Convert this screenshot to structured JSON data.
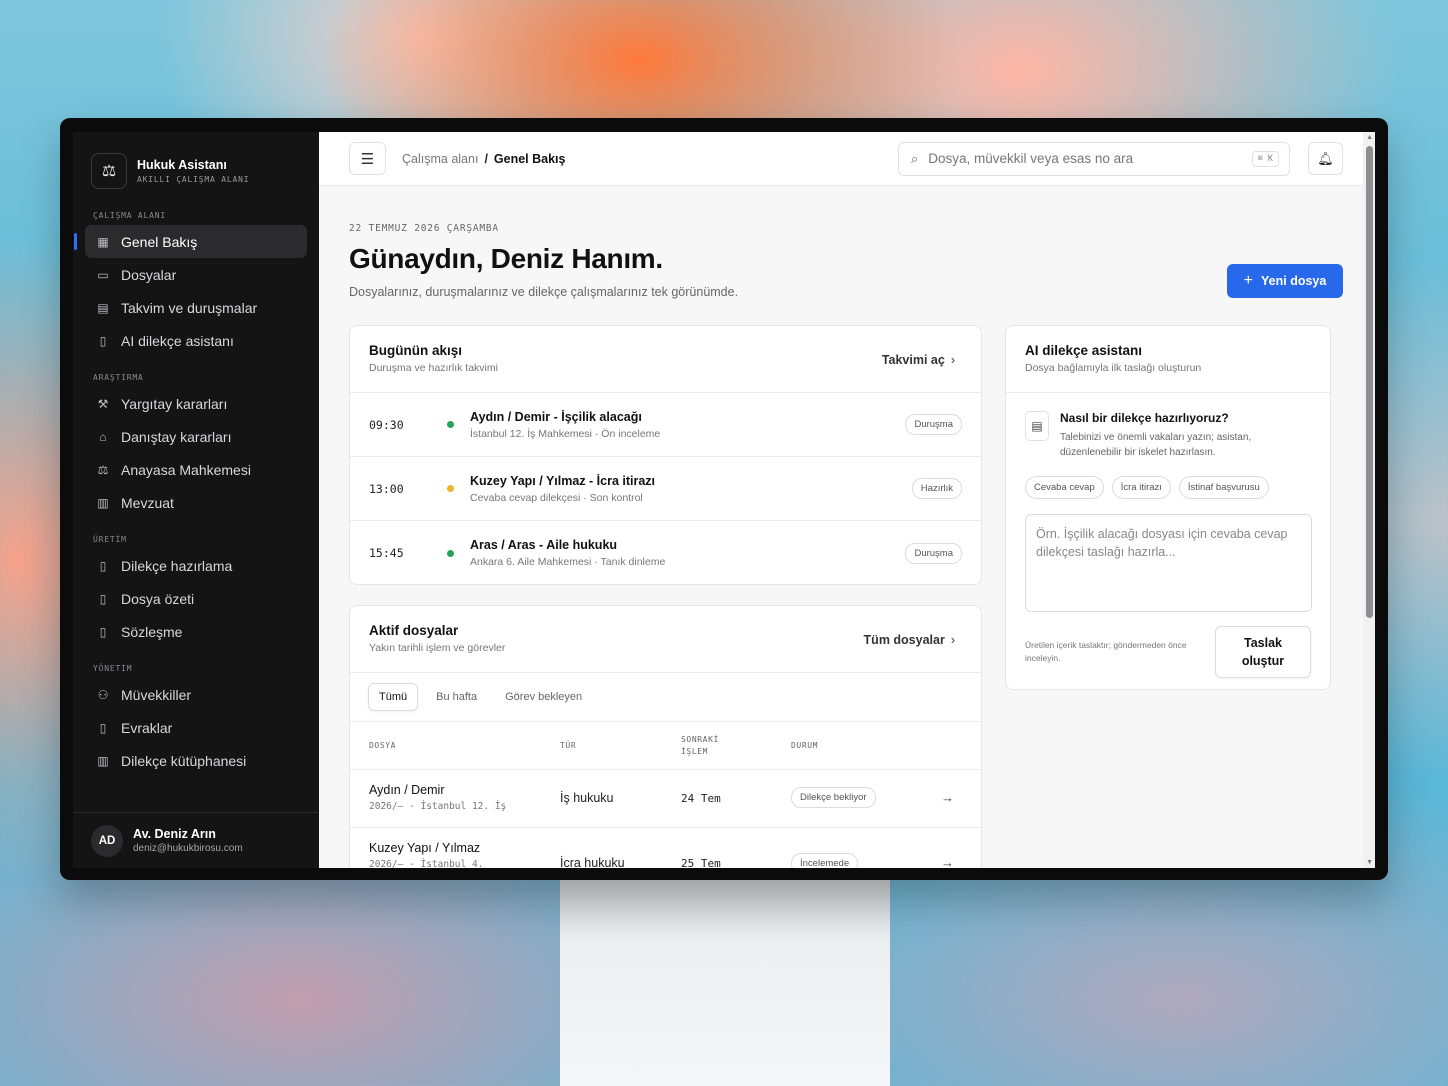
{
  "app": {
    "name": "Hukuk Asistanı",
    "subtitle": "AKILLI ÇALIŞMA ALANI"
  },
  "sidebar": {
    "sections": [
      {
        "title": "ÇALIŞMA ALANI",
        "items": [
          {
            "label": "Genel Bakış",
            "icon": "grid-icon",
            "active": true
          },
          {
            "label": "Dosyalar",
            "icon": "folder-icon"
          },
          {
            "label": "Takvim ve duruşmalar",
            "icon": "calendar-icon"
          },
          {
            "label": "AI dilekçe asistanı",
            "icon": "document-icon"
          }
        ]
      },
      {
        "title": "ARAŞTIRMA",
        "items": [
          {
            "label": "Yargıtay kararları",
            "icon": "gavel-icon"
          },
          {
            "label": "Danıştay kararları",
            "icon": "landmark-icon"
          },
          {
            "label": "Anayasa Mahkemesi",
            "icon": "scales-icon"
          },
          {
            "label": "Mevzuat",
            "icon": "book-icon"
          }
        ]
      },
      {
        "title": "ÜRETİM",
        "items": [
          {
            "label": "Dilekçe hazırlama",
            "icon": "file-edit-icon"
          },
          {
            "label": "Dosya özeti",
            "icon": "file-text-icon"
          },
          {
            "label": "Sözleşme",
            "icon": "contract-icon"
          }
        ]
      },
      {
        "title": "YÖNETİM",
        "items": [
          {
            "label": "Müvekkiller",
            "icon": "users-icon"
          },
          {
            "label": "Evraklar",
            "icon": "file-icon"
          },
          {
            "label": "Dilekçe kütüphanesi",
            "icon": "library-icon"
          }
        ]
      }
    ]
  },
  "user": {
    "initials": "AD",
    "name": "Av. Deniz Arın",
    "email": "deniz@hukukbirosu.com"
  },
  "topbar": {
    "breadcrumb_parent": "Çalışma alanı",
    "breadcrumb_sep": "/",
    "breadcrumb_current": "Genel Bakış",
    "search_placeholder": "Dosya, müvekkil veya esas no ara",
    "search_shortcut": "⌘ K"
  },
  "header": {
    "date": "22 TEMMUZ 2026 ÇARŞAMBA",
    "greeting": "Günaydın, Deniz Hanım.",
    "subtitle": "Dosyalarınız, duruşmalarınız ve dilekçe çalışmalarınız tek görünümde.",
    "new_button": "Yeni dosya"
  },
  "today_flow": {
    "title": "Bugünün akışı",
    "subtitle": "Duruşma ve hazırlık takvimi",
    "link": "Takvimi aç",
    "items": [
      {
        "time": "09:30",
        "title": "Aydın / Demir - İşçilik alacağı",
        "meta": "İstanbul 12. İş Mahkemesi · Ön inceleme",
        "badge": "Duruşma",
        "dot_color": "#22a55a"
      },
      {
        "time": "13:00",
        "title": "Kuzey Yapı / Yılmaz - İcra itirazı",
        "meta": "Cevaba cevap dilekçesi · Son kontrol",
        "badge": "Hazırlık",
        "dot_color": "#e8b528"
      },
      {
        "time": "15:45",
        "title": "Aras / Aras - Aile hukuku",
        "meta": "Ankara 6. Aile Mahkemesi · Tanık dinleme",
        "badge": "Duruşma",
        "dot_color": "#22a55a"
      }
    ]
  },
  "active_files": {
    "title": "Aktif dosyalar",
    "subtitle": "Yakın tarihli işlem ve görevler",
    "link": "Tüm dosyalar",
    "tabs": [
      "Tümü",
      "Bu hafta",
      "Görev bekleyen"
    ],
    "columns": {
      "file": "DOSYA",
      "type": "TÜR",
      "next_1": "SONRAKİ",
      "next_2": "İŞLEM",
      "status": "DURUM"
    },
    "rows": [
      {
        "name": "Aydın / Demir",
        "ref": "2026/— - İstanbul 12. İş",
        "type": "İş hukuku",
        "next": "24 Tem",
        "status": "Dilekçe bekliyor"
      },
      {
        "name": "Kuzey Yapı / Yılmaz",
        "ref": "2026/— - İstanbul 4.",
        "type": "İcra hukuku",
        "next": "25 Tem",
        "status": "İncelemede"
      }
    ]
  },
  "ai_assistant": {
    "title": "AI dilekçe asistanı",
    "subtitle": "Dosya bağlamıyla ilk taslağı oluşturun",
    "question": "Nasıl bir dilekçe hazırlıyoruz?",
    "description": "Talebinizi ve önemli vakaları yazın; asistan, düzenlenebilir bir iskelet hazırlasın.",
    "chips": [
      "Cevaba cevap",
      "İcra itirazı",
      "İstinaf başvurusu"
    ],
    "placeholder": "Örn. İşçilik alacağı dosyası için cevaba cevap dilekçesi taslağı hazırla...",
    "note": "Üretilen içerik taslaktır; göndermeden önce inceleyin.",
    "button_line1": "Taslak",
    "button_line2": "oluştur"
  },
  "colors": {
    "accent": "#2869ec",
    "sidebar_bg": "#141415",
    "success": "#22a55a",
    "warning": "#e8b528"
  }
}
